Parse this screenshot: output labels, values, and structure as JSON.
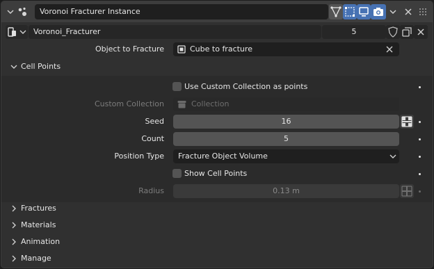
{
  "header": {
    "modifier_name": "Voronoi Fracturer Instance"
  },
  "node_group": {
    "name": "Voronoi_Fracturer",
    "users": "5"
  },
  "object_field": {
    "label": "Object to Fracture",
    "value": "Cube to fracture"
  },
  "cell_points": {
    "title": "Cell Points",
    "use_custom_collection_label": "Use Custom Collection as points",
    "custom_collection_label": "Custom Collection",
    "custom_collection_placeholder": "Collection",
    "seed_label": "Seed",
    "seed_value": "16",
    "count_label": "Count",
    "count_value": "5",
    "position_type_label": "Position Type",
    "position_type_value": "Fracture Object Volume",
    "show_cell_points_label": "Show Cell Points",
    "radius_label": "Radius",
    "radius_value": "0.13 m"
  },
  "sections": {
    "fractures": "Fractures",
    "materials": "Materials",
    "animation": "Animation",
    "manage": "Manage"
  },
  "colors": {
    "active_toggle": "#4772b3",
    "panel_bg": "#303030",
    "field_bg": "#1f1f1f",
    "slider_bg": "#545454"
  }
}
